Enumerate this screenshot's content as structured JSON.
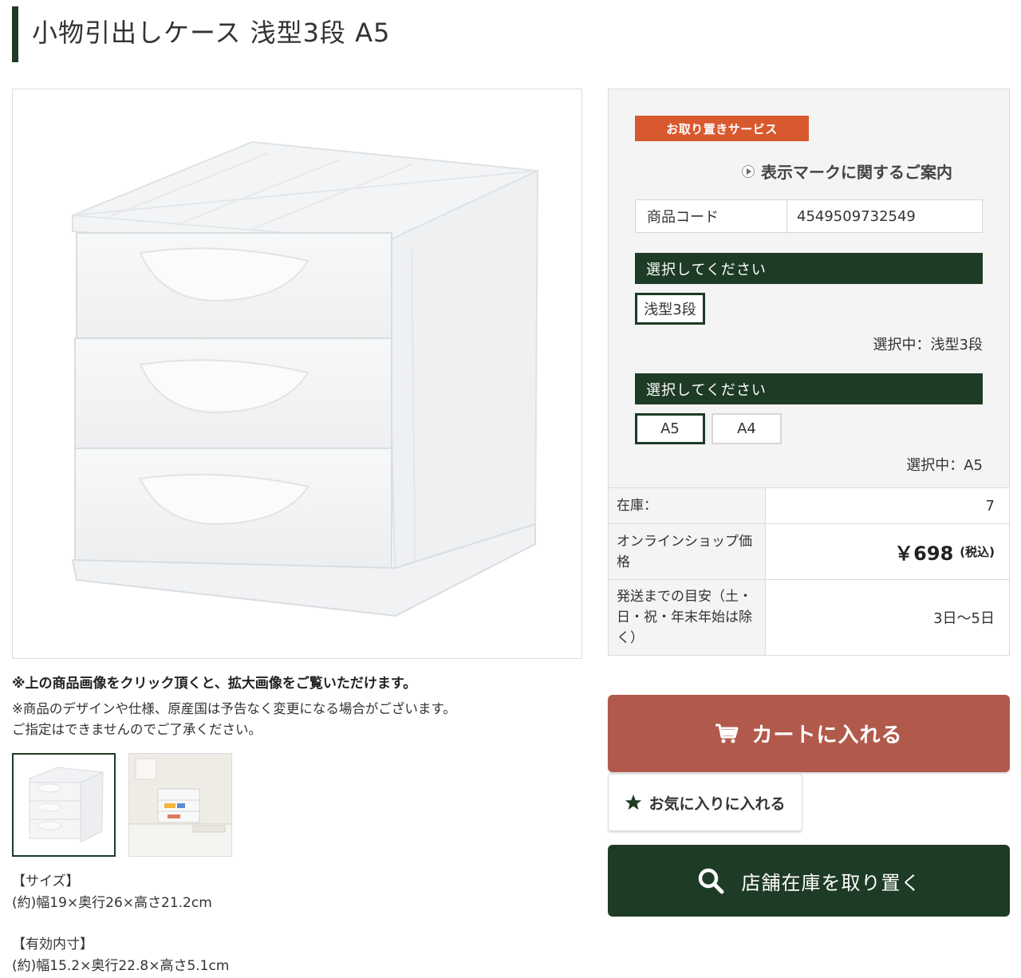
{
  "product": {
    "title": "小物引出しケース 浅型3段 A5"
  },
  "image_notes": {
    "click_note": "※上の商品画像をクリック頂くと、拡大画像をご覧いただけます。",
    "disclaimer_line1": "※商品のデザインや仕様、原産国は予告なく変更になる場合がございます。",
    "disclaimer_line2": "ご指定はできませんのでご了承ください。"
  },
  "specs": {
    "size_heading": "【サイズ】",
    "size_value": "(約)幅19×奥行26×高さ21.2cm",
    "inner_heading": "【有効内寸】",
    "inner_value": "(約)幅15.2×奥行22.8×高さ5.1cm"
  },
  "panel": {
    "badge": "お取り置きサービス",
    "guide_link": "表示マークに関するご案内",
    "code_label": "商品コード",
    "code_value": "4549509732549",
    "variant1": {
      "header": "選択してください",
      "options": [
        "浅型3段"
      ],
      "selected": "選択中：浅型3段"
    },
    "variant2": {
      "header": "選択してください",
      "options": [
        "A5",
        "A4"
      ],
      "selected": "選択中：A5"
    },
    "stock_label": "在庫：",
    "stock_value": "7",
    "price_label": "オンラインショップ価格",
    "price_value": "￥698",
    "price_tax": "(税込)",
    "ship_label": "発送までの目安（土・日・祝・年末年始は除く）",
    "ship_value": "3日〜5日"
  },
  "buttons": {
    "cart": "カートに入れる",
    "favorite": "お気に入りに入れる",
    "store": "店舗在庫を取り置く"
  },
  "colors": {
    "brand_green": "#1e3b25",
    "badge_orange": "#d9592f",
    "cart_red": "#b15a4c"
  }
}
